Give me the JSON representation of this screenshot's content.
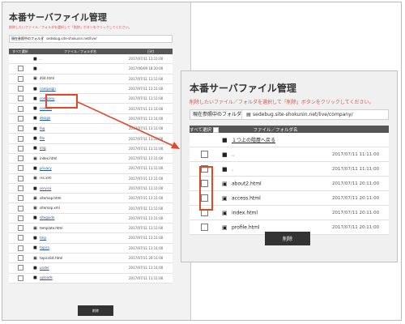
{
  "title": "本番サーバファイル管理",
  "instruction": "削除したいファイル／フォルダを選択して「削除」ボタンをクリックしてください。",
  "current_folder": {
    "label": "現在参照中のフォルダ",
    "back_path": "sedebug.site-shokunin.net/live/",
    "front_path": "sedebug.site-shokunin.net/live/company/"
  },
  "table_headers": {
    "select_all": "すべて選択",
    "name": "ファイル／フォルダ名",
    "date": "日付"
  },
  "back_rows": [
    {
      "icon": "folder-up-icon",
      "name": "..",
      "link": false,
      "date": "2017/07/11 11:11:00"
    },
    {
      "icon": "folder-icon",
      "name": ".",
      "link": false,
      "date": "2017/06/09 18:20:00"
    },
    {
      "icon": "file-icon",
      "name": "404.html",
      "link": false,
      "date": "2017/07/11 11:11:00"
    },
    {
      "icon": "folder-icon",
      "name": "campaign",
      "link": true,
      "date": "2017/07/11 11:11:00"
    },
    {
      "icon": "folder-icon",
      "name": "company",
      "link": true,
      "date": "2017/07/11 11:11:00"
    },
    {
      "icon": "folder-icon",
      "name": "contact",
      "link": true,
      "date": "2017/07/11 11:11:00"
    },
    {
      "icon": "folder-icon",
      "name": "design",
      "link": true,
      "date": "2017/07/11 11:11:00"
    },
    {
      "icon": "folder-icon",
      "name": "faq",
      "link": true,
      "date": "2017/07/11 11:11:00"
    },
    {
      "icon": "folder-icon",
      "name": "file",
      "link": true,
      "date": "2017/07/11 11:11:00"
    },
    {
      "icon": "folder-icon",
      "name": "img",
      "link": true,
      "date": "2017/07/11 11:11:00"
    },
    {
      "icon": "file-icon",
      "name": "index.html",
      "link": false,
      "date": "2017/07/11 11:11:00"
    },
    {
      "icon": "folder-icon",
      "name": "privacy",
      "link": true,
      "date": "2017/07/11 11:11:00"
    },
    {
      "icon": "file-icon",
      "name": "rss.xml",
      "link": false,
      "date": "2017/07/11 11:11:00"
    },
    {
      "icon": "folder-icon",
      "name": "service",
      "link": true,
      "date": "2017/07/11 11:11:00"
    },
    {
      "icon": "file-icon",
      "name": "sitemap.html",
      "link": false,
      "date": "2017/07/11 11:11:00"
    },
    {
      "icon": "file-icon",
      "name": "sitemap.xml",
      "link": false,
      "date": "2017/07/11 11:11:00"
    },
    {
      "icon": "folder-icon",
      "name": "siteguide",
      "link": true,
      "date": "2017/07/11 11:11:00"
    },
    {
      "icon": "file-icon",
      "name": "template.html",
      "link": false,
      "date": "2017/07/11 11:11:00"
    },
    {
      "icon": "folder-icon",
      "name": "tmp",
      "link": true,
      "date": "2017/07/11 11:11:00"
    },
    {
      "icon": "folder-icon",
      "name": "topics",
      "link": true,
      "date": "2017/07/11 11:11:00"
    },
    {
      "icon": "file-icon",
      "name": "topicslist.html",
      "link": false,
      "date": "2017/07/11 20:11:00"
    },
    {
      "icon": "folder-icon",
      "name": "under",
      "link": true,
      "date": "2017/07/11 11:11:00"
    },
    {
      "icon": "folder-icon",
      "name": "uploads",
      "link": true,
      "date": "2017/07/11 11:11:00"
    }
  ],
  "front_rows": [
    {
      "icon": "folder-up-icon",
      "name": "１つ上の階層へ戻る",
      "link": true,
      "date": "",
      "checkbox": false
    },
    {
      "icon": "folder-icon",
      "name": "..",
      "link": false,
      "date": "2017/07/11 11:11:00",
      "checkbox": true
    },
    {
      "icon": "folder-icon",
      "name": ".",
      "link": false,
      "date": "2017/07/11 11:11:00",
      "checkbox": true
    },
    {
      "icon": "file-icon",
      "name": "about2.html",
      "link": false,
      "date": "2017/07/11 20:11:00",
      "checkbox": true
    },
    {
      "icon": "file-icon",
      "name": "access.html",
      "link": false,
      "date": "2017/07/11 20:11:00",
      "checkbox": true
    },
    {
      "icon": "file-icon",
      "name": "index.html",
      "link": false,
      "date": "2017/07/11 20:11:00",
      "checkbox": true
    },
    {
      "icon": "file-icon",
      "name": "profile.html",
      "link": false,
      "date": "2017/07/11 20:11:00",
      "checkbox": true
    }
  ],
  "delete_label": "削除",
  "colors": {
    "highlight": "#e04a2a",
    "instruction": "#d9534f",
    "header_bg": "#555555",
    "button_bg": "#333333"
  }
}
